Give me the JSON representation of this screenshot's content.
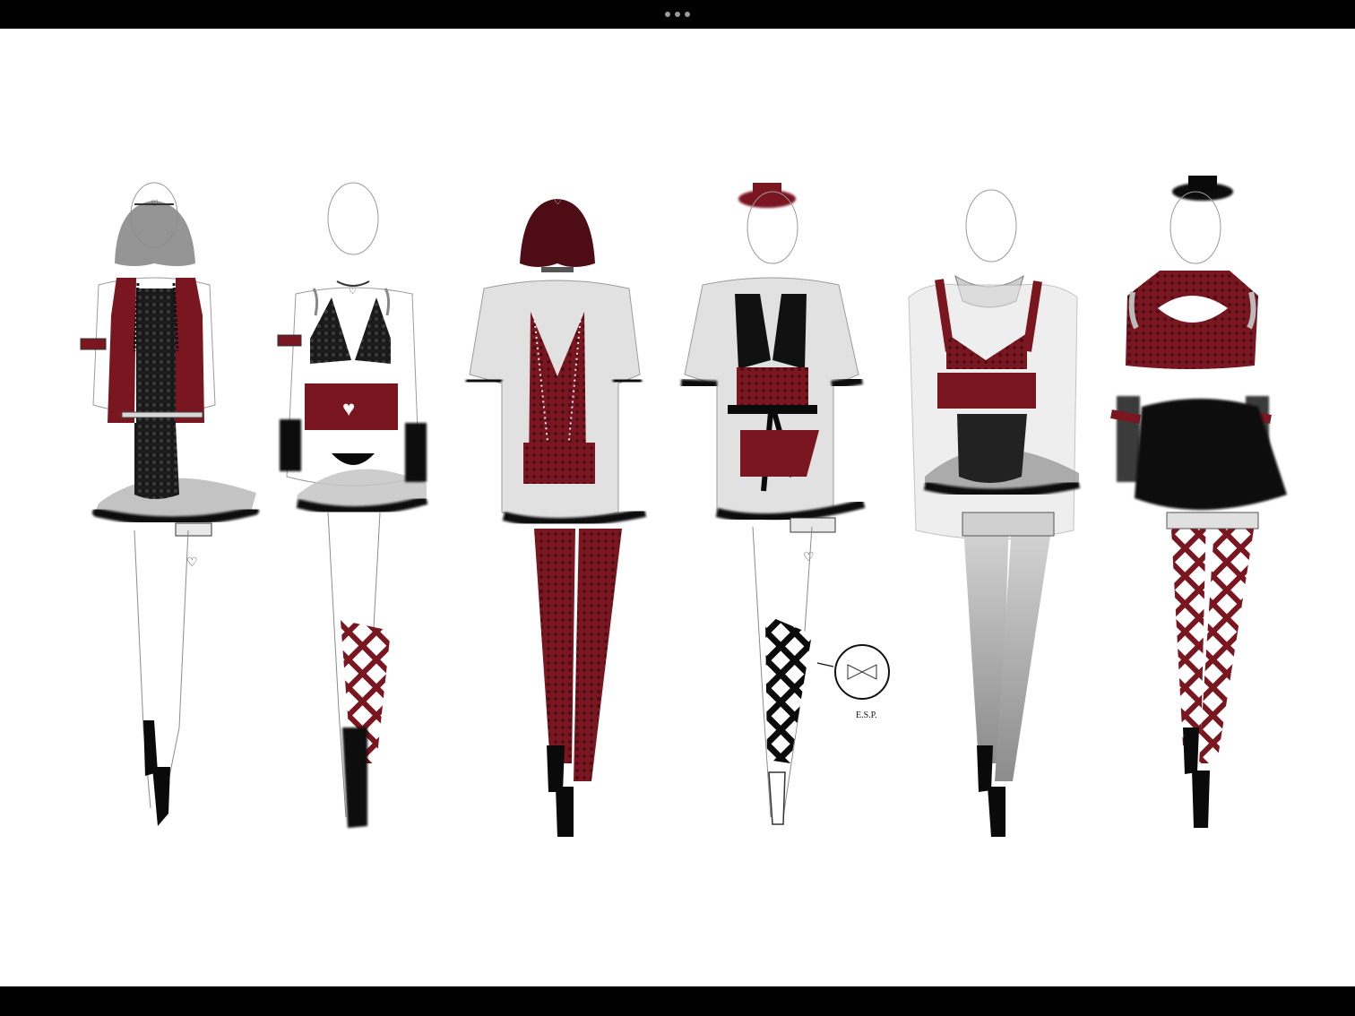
{
  "viewer": {
    "menu_icon": "more-dots-icon",
    "colors": {
      "bar": "#000000",
      "canvas": "#ffffff",
      "burgundy": "#7a1620",
      "burgundy_dark": "#4e0d14",
      "black": "#0a0a0a",
      "sheer": "#c9c9c9",
      "outline": "#8a8a8a"
    }
  },
  "illustration": {
    "detail_note": "E.S.P."
  }
}
